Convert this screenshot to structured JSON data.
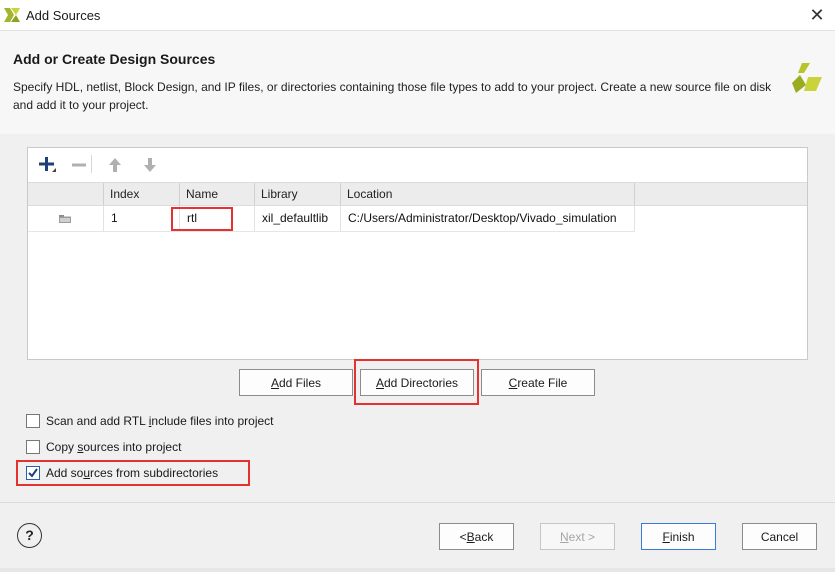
{
  "window": {
    "title": "Add Sources",
    "close_glyph": "✕"
  },
  "header": {
    "heading": "Add or Create Design Sources",
    "description": "Specify HDL, netlist, Block Design, and IP files, or directories containing those file types to add to your project. Create a new source file on disk and add it to your project."
  },
  "toolbar": {
    "icons": [
      "add-icon",
      "remove-icon",
      "move-up-icon",
      "move-down-icon"
    ]
  },
  "table": {
    "columns": [
      "Index",
      "Name",
      "Library",
      "Location"
    ],
    "rows": [
      {
        "index": "1",
        "name": "rtl",
        "library": "xil_defaultlib",
        "location": "C:/Users/Administrator/Desktop/Vivado_simulation",
        "icon": "folder-icon"
      }
    ]
  },
  "buttons": {
    "add_files": {
      "pre": "",
      "ul": "A",
      "post": "dd Files"
    },
    "add_directories": {
      "pre": "",
      "ul": "A",
      "post": "dd Directories"
    },
    "create_file": {
      "pre": "",
      "ul": "C",
      "post": "reate File"
    }
  },
  "options": {
    "scan_rtl": {
      "pre": "Scan and add RTL ",
      "ul": "i",
      "post": "nclude files into project",
      "checked": false
    },
    "copy_sources": {
      "pre": "Copy ",
      "ul": "s",
      "post": "ources into project",
      "checked": false
    },
    "add_subdirs": {
      "pre": "Add so",
      "ul": "u",
      "post": "rces from subdirectories",
      "checked": true
    }
  },
  "footer": {
    "help": "?",
    "back": {
      "pre": "< ",
      "ul": "B",
      "post": "ack"
    },
    "next": {
      "pre": "",
      "ul": "N",
      "post": "ext >"
    },
    "finish": {
      "pre": "",
      "ul": "F",
      "post": "inish"
    },
    "cancel": "Cancel"
  },
  "colors": {
    "highlight_red": "#e5312f",
    "accent_blue": "#2a5ea8",
    "xilinx_yellow": "#c9d43a"
  }
}
